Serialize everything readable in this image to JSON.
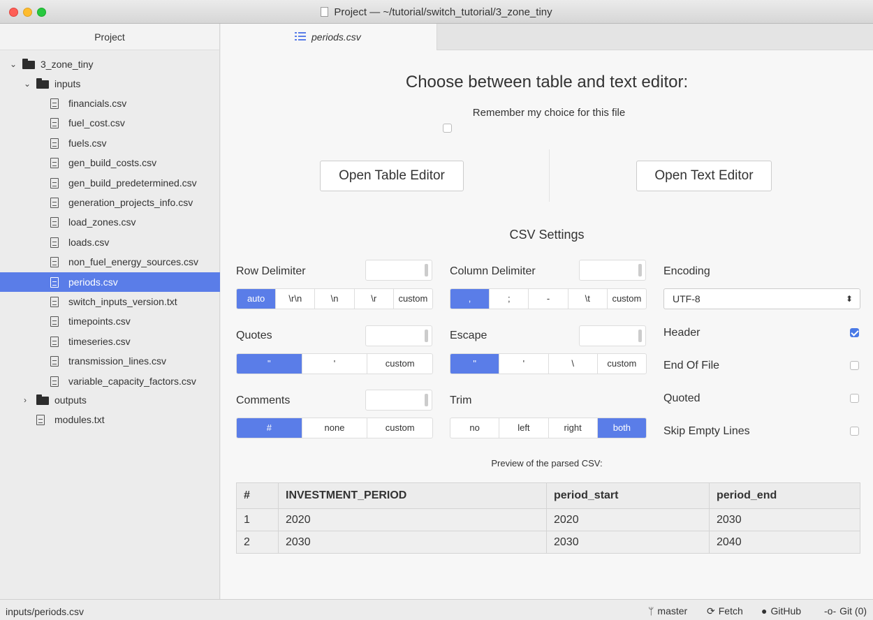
{
  "window": {
    "title": "Project — ~/tutorial/switch_tutorial/3_zone_tiny"
  },
  "sidebar": {
    "header": "Project",
    "root": "3_zone_tiny",
    "inputs_folder": "inputs",
    "input_files": [
      "financials.csv",
      "fuel_cost.csv",
      "fuels.csv",
      "gen_build_costs.csv",
      "gen_build_predetermined.csv",
      "generation_projects_info.csv",
      "load_zones.csv",
      "loads.csv",
      "non_fuel_energy_sources.csv",
      "periods.csv",
      "switch_inputs_version.txt",
      "timepoints.csv",
      "timeseries.csv",
      "transmission_lines.csv",
      "variable_capacity_factors.csv"
    ],
    "selected": "periods.csv",
    "outputs_folder": "outputs",
    "modules_file": "modules.txt"
  },
  "tab": {
    "label": "periods.csv"
  },
  "editor_choice": {
    "heading": "Choose between table and text editor:",
    "remember_label": "Remember my choice for this file",
    "open_table": "Open Table Editor",
    "open_text": "Open Text Editor"
  },
  "csv_settings": {
    "title": "CSV Settings",
    "row_delimiter": {
      "label": "Row Delimiter",
      "options": [
        "auto",
        "\\r\\n",
        "\\n",
        "\\r",
        "custom"
      ],
      "selected": "auto"
    },
    "column_delimiter": {
      "label": "Column Delimiter",
      "options": [
        ",",
        ";",
        "-",
        "\\t",
        "custom"
      ],
      "selected": ","
    },
    "quotes": {
      "label": "Quotes",
      "options": [
        "\"",
        "'",
        "custom"
      ],
      "selected": "\""
    },
    "escape": {
      "label": "Escape",
      "options": [
        "\"",
        "'",
        "\\",
        "custom"
      ],
      "selected": "\""
    },
    "comments": {
      "label": "Comments",
      "options": [
        "#",
        "none",
        "custom"
      ],
      "selected": "#"
    },
    "trim": {
      "label": "Trim",
      "options": [
        "no",
        "left",
        "right",
        "both"
      ],
      "selected": "both"
    },
    "encoding": {
      "label": "Encoding",
      "value": "UTF-8"
    },
    "header": {
      "label": "Header",
      "checked": true
    },
    "end_of_file": {
      "label": "End Of File",
      "checked": false
    },
    "quoted": {
      "label": "Quoted",
      "checked": false
    },
    "skip_empty": {
      "label": "Skip Empty Lines",
      "checked": false
    }
  },
  "preview": {
    "caption": "Preview of the parsed CSV:",
    "columns": [
      "#",
      "INVESTMENT_PERIOD",
      "period_start",
      "period_end"
    ],
    "rows": [
      [
        "1",
        "2020",
        "2020",
        "2030"
      ],
      [
        "2",
        "2030",
        "2030",
        "2040"
      ]
    ]
  },
  "statusbar": {
    "path": "inputs/periods.csv",
    "branch": "master",
    "fetch": "Fetch",
    "github": "GitHub",
    "git": "Git (0)"
  },
  "colors": {
    "accent": "#5a7de8"
  }
}
